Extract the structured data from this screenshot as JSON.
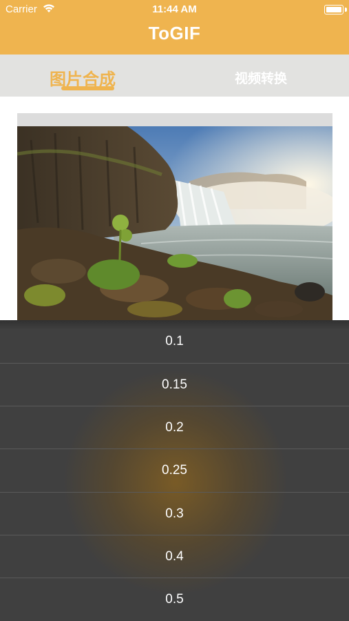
{
  "status_bar": {
    "carrier": "Carrier",
    "time": "11:44 AM"
  },
  "header": {
    "title": "ToGIF",
    "background_color": "#efb44f"
  },
  "tabs": [
    {
      "label": "图片合成",
      "active": true
    },
    {
      "label": "视频转换",
      "active": false
    }
  ],
  "preview": {
    "image": "waterfall-landscape-photo"
  },
  "picker": {
    "options": [
      "0.1",
      "0.15",
      "0.2",
      "0.25",
      "0.3",
      "0.4",
      "0.5"
    ]
  },
  "colors": {
    "accent": "#efb44f",
    "sheet": "#404040",
    "tab_bar": "#e2e2e0"
  }
}
